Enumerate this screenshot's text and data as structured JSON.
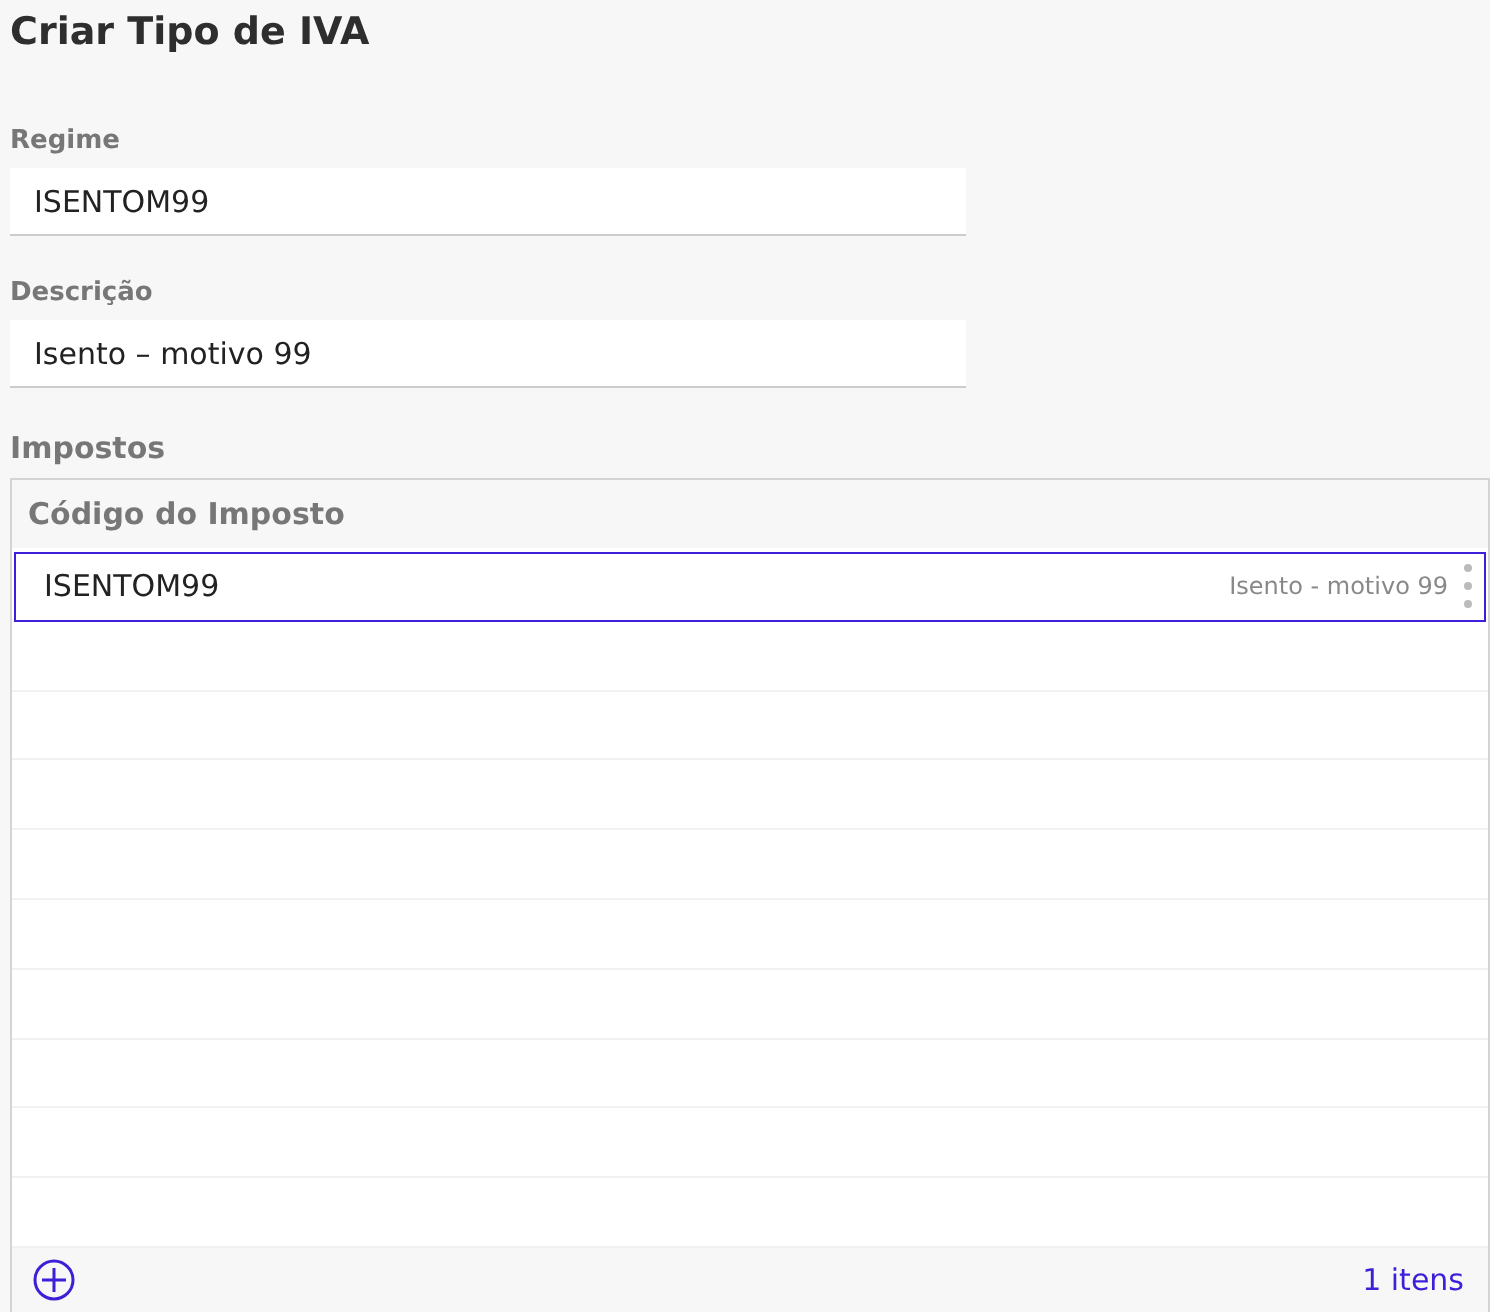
{
  "title": "Criar Tipo de IVA",
  "fields": [
    {
      "label": "Regime",
      "value": "ISENTOM99"
    },
    {
      "label": "Descrição",
      "value": "Isento – motivo 99"
    }
  ],
  "section": "Impostos",
  "table": {
    "column_header": "Código do Imposto",
    "rows": [
      {
        "code": "ISENTOM99",
        "description": "Isento - motivo 99",
        "selected": true
      }
    ],
    "footer": {
      "count": "1 itens"
    }
  }
}
